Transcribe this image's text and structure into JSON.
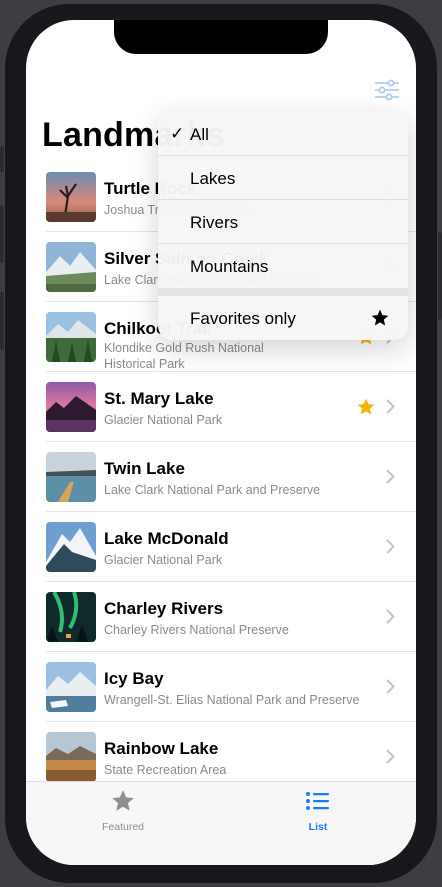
{
  "screen": {
    "title": "Landmarks"
  },
  "filter_menu": {
    "options": [
      {
        "label": "All",
        "checked": true
      },
      {
        "label": "Lakes",
        "checked": false
      },
      {
        "label": "Rivers",
        "checked": false
      },
      {
        "label": "Mountains",
        "checked": false
      }
    ],
    "favorites_label": "Favorites only"
  },
  "landmarks": [
    {
      "name": "Turtle Rock",
      "park": "Joshua Tree National Park",
      "favorite": false
    },
    {
      "name": "Silver Salmon Creek",
      "park": "Lake Clark National Park and Preserve",
      "favorite": false
    },
    {
      "name": "Chilkoot Trail",
      "park": "Klondike Gold Rush National Historical Park",
      "favorite": true
    },
    {
      "name": "St. Mary Lake",
      "park": "Glacier National Park",
      "favorite": true
    },
    {
      "name": "Twin Lake",
      "park": "Lake Clark National Park and Preserve",
      "favorite": false
    },
    {
      "name": "Lake McDonald",
      "park": "Glacier National Park",
      "favorite": false
    },
    {
      "name": "Charley Rivers",
      "park": "Charley Rivers National Preserve",
      "favorite": false
    },
    {
      "name": "Icy Bay",
      "park": "Wrangell-St. Elias National Park and Preserve",
      "favorite": false
    },
    {
      "name": "Rainbow Lake",
      "park": "State Recreation Area",
      "favorite": false
    }
  ],
  "tabbar": {
    "featured_label": "Featured",
    "list_label": "List",
    "selected": "List"
  },
  "colors": {
    "accent": "#1a7cf5",
    "favorite_star": "#f4b400",
    "inactive_tab": "#8e8e93"
  },
  "icons": {
    "filter": "slider-horizontal-icon",
    "favorite": "star-fill-icon",
    "row_disclosure": "chevron-right-icon",
    "featured_tab": "star-fill-icon",
    "list_tab": "list-bullet-icon"
  }
}
